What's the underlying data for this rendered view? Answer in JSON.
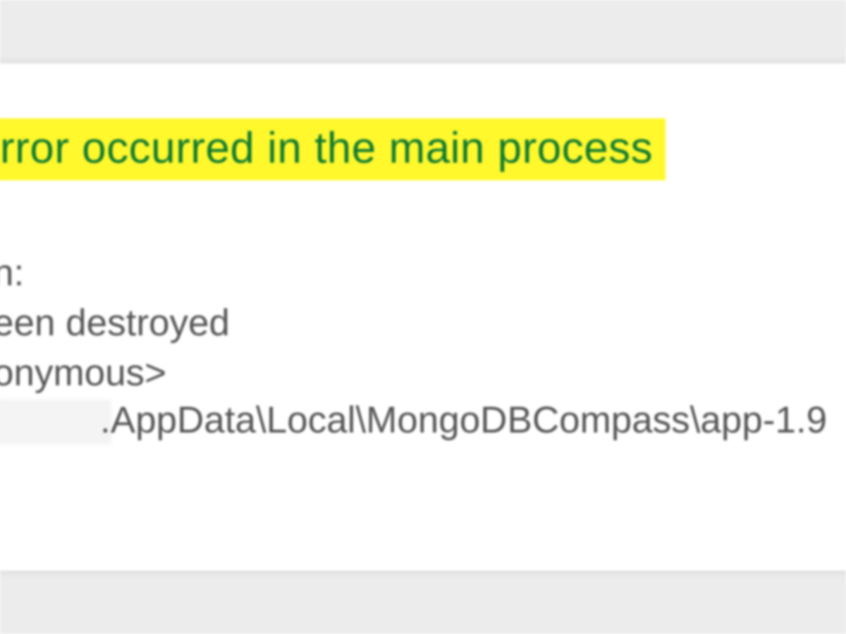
{
  "dialog": {
    "title_fragment": "rror occurred in the main process",
    "body": {
      "line1_fragment": "n:",
      "line2_fragment": "een destroyed",
      "line3_fragment": "onymous>",
      "path_fragment": ".AppData\\Local\\MongoDBCompass\\app-1.9"
    }
  },
  "colors": {
    "highlight_bg": "#fff82d",
    "title_text": "#0f7a2e",
    "body_text": "#555555",
    "band_bg": "#ececec"
  }
}
